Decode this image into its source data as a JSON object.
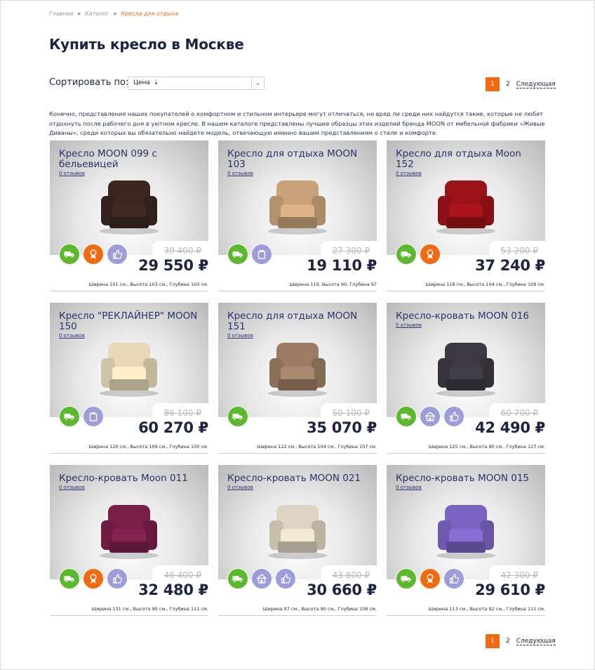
{
  "breadcrumb": [
    "Главная",
    "Каталог",
    "Кресла для отдыха"
  ],
  "page_title": "Купить кресло в Москве",
  "sort": {
    "label": "Сортировать по:",
    "value": "Цена",
    "icon": "sort-desc-icon"
  },
  "pagination": {
    "current": "1",
    "next_page": "2",
    "next_label": "Следующая"
  },
  "intro_text": "Конечно, представления наших покупателей о комфортном и стильном интерьере могут отличаться, но вряд ли среди них найдутся такие, которые не любят отдохнуть после рабочего дня в уютном кресле. В нашем каталоге представлены лучшие образцы этих изделий бренда MOON от мебельной фабрики «Живые Диваны», среди которых вы обязательно найдете модель, отвечающую именно вашим представлениям о стиле и комфорте.",
  "colors": {
    "accent": "#f26a10",
    "title": "#1d2340",
    "badge_green": "#5cb82e",
    "badge_orange": "#f26a10",
    "badge_lilac": "#9d9dd9"
  },
  "products": [
    {
      "name": "Кресло MOON 099 с бельевицей",
      "reviews": "0 отзывов",
      "old_price": "39 400 ₽",
      "price": "29 550 ₽",
      "dims": "Ширина 101 см., Высота 103 см., Глубина 103 см.",
      "badges": [
        "delivery",
        "award",
        "comfort"
      ],
      "chair_color": "#3b2620"
    },
    {
      "name": "Кресло для отдыха MOON 103",
      "reviews": "0 отзывов",
      "old_price": "27 300 ₽",
      "price": "19 110 ₽",
      "dims": "Ширина 119, Высота 90, Глубина 97",
      "badges": [
        "delivery",
        "storage"
      ],
      "chair_color": "#c9a27a"
    },
    {
      "name": "Кресло для отдыха Moon 152",
      "reviews": "0 отзывов",
      "old_price": "53 200 ₽",
      "price": "37 240 ₽",
      "dims": "Ширина 118 см., Высота 104 см., Глубина 109 см.",
      "badges": [
        "delivery",
        "award"
      ],
      "chair_color": "#9c1219"
    },
    {
      "name": "Кресло \"РЕКЛАЙНЕР\" MOON 150",
      "reviews": "0 отзывов",
      "old_price": "86 100 ₽",
      "price": "60 270 ₽",
      "dims": "Ширина 120 см., Высота 109 см., Глубина 100 см.",
      "badges": [
        "delivery",
        "storage"
      ],
      "chair_color": "#e7d8b8"
    },
    {
      "name": "Кресло для отдыха MOON 151",
      "reviews": "0 отзывов",
      "old_price": "50 100 ₽",
      "price": "35 070 ₽",
      "dims": "Ширина 122 см., Высота 104 см., Глубина 107 см.",
      "badges": [
        "delivery"
      ],
      "chair_color": "#9a7d64"
    },
    {
      "name": "Кресло-кровать MOON 016",
      "reviews": "0 отзывов",
      "old_price": "60 700 ₽",
      "price": "42 490 ₽",
      "dims": "Ширина 125 см., Высота 90 см., Глубина 127 см.",
      "badges": [
        "delivery",
        "house",
        "comfort"
      ],
      "chair_color": "#3c3a40"
    },
    {
      "name": "Кресло-кровать Moon 011",
      "reviews": "0 отзывов",
      "old_price": "46 400 ₽",
      "price": "32 480 ₽",
      "dims": "Ширина 131 см., Высота 90 см., Глубина 111 см.",
      "badges": [
        "delivery",
        "award",
        "comfort"
      ],
      "chair_color": "#7a1f4a"
    },
    {
      "name": "Кресло-кровать MOON 021",
      "reviews": "0 отзывов",
      "old_price": "43 800 ₽",
      "price": "30 660 ₽",
      "dims": "Ширина 97 см., Высота 90 см., Глубина 108 см.",
      "badges": [
        "delivery",
        "house",
        "comfort"
      ],
      "chair_color": "#ddd3c0"
    },
    {
      "name": "Кресло-кровать MOON 015",
      "reviews": "0 отзывов",
      "old_price": "42 300 ₽",
      "price": "29 610 ₽",
      "dims": "Ширина 113 см., Высота 92 см., Глубина 111 см.",
      "badges": [
        "delivery",
        "award",
        "comfort"
      ],
      "chair_color": "#7a64c2"
    }
  ]
}
